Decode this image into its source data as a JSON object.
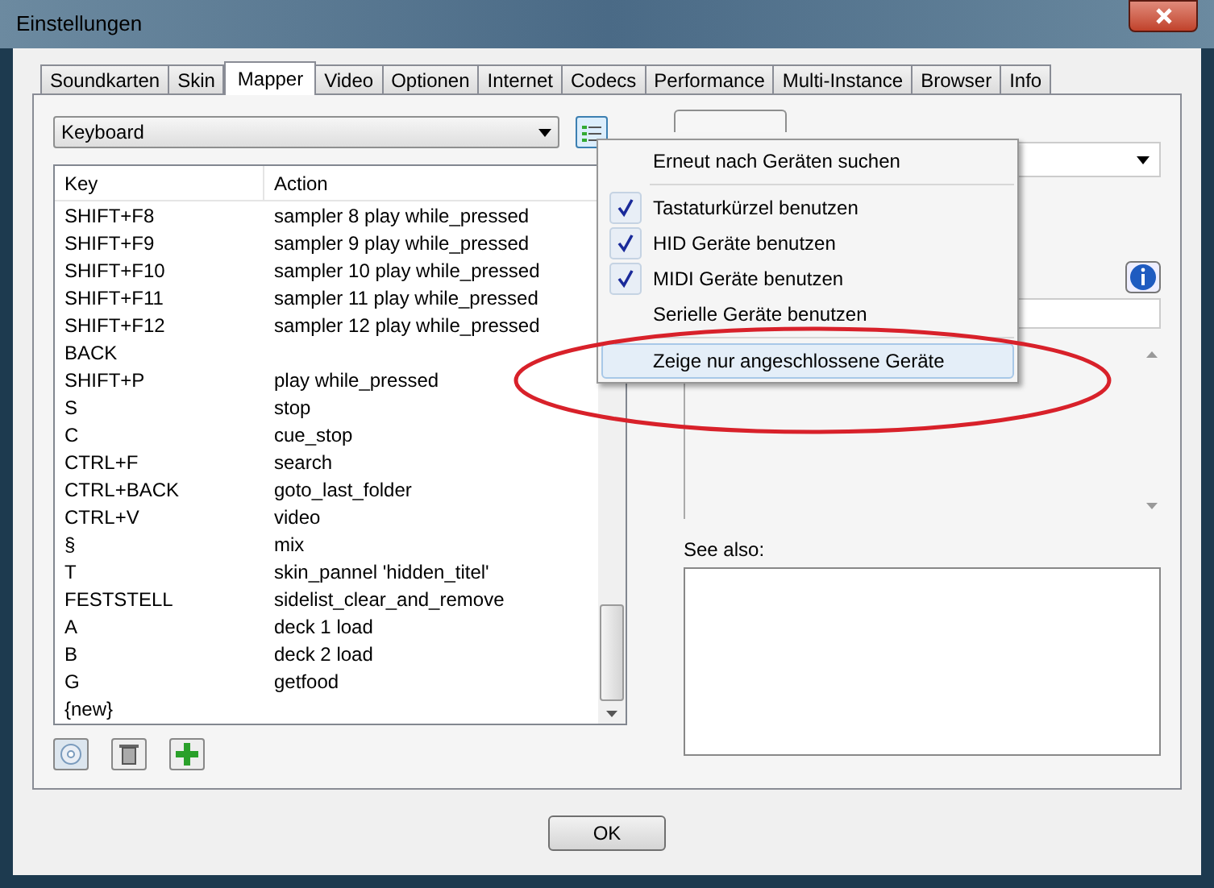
{
  "window": {
    "title": "Einstellungen"
  },
  "tabs": [
    {
      "label": "Soundkarten",
      "selected": false
    },
    {
      "label": "Skin",
      "selected": false
    },
    {
      "label": "Mapper",
      "selected": true
    },
    {
      "label": "Video",
      "selected": false
    },
    {
      "label": "Optionen",
      "selected": false
    },
    {
      "label": "Internet",
      "selected": false
    },
    {
      "label": "Codecs",
      "selected": false
    },
    {
      "label": "Performance",
      "selected": false
    },
    {
      "label": "Multi-Instance",
      "selected": false
    },
    {
      "label": "Browser",
      "selected": false
    },
    {
      "label": "Info",
      "selected": false
    }
  ],
  "device_select": {
    "value": "Keyboard"
  },
  "key_table": {
    "columns": [
      "Key",
      "Action"
    ],
    "rows": [
      {
        "key": "SHIFT+F8",
        "action": "sampler 8 play while_pressed"
      },
      {
        "key": "SHIFT+F9",
        "action": "sampler 9 play while_pressed"
      },
      {
        "key": "SHIFT+F10",
        "action": "sampler 10 play while_pressed"
      },
      {
        "key": "SHIFT+F11",
        "action": "sampler 11 play while_pressed"
      },
      {
        "key": "SHIFT+F12",
        "action": "sampler 12 play while_pressed"
      },
      {
        "key": "BACK"
      },
      {
        "key": "SHIFT+P",
        "action": "play while_pressed"
      },
      {
        "key": "S",
        "action": "stop"
      },
      {
        "key": "C",
        "action": "cue_stop"
      },
      {
        "key": "CTRL+F",
        "action": "search"
      },
      {
        "key": "CTRL+BACK",
        "action": "goto_last_folder"
      },
      {
        "key": "CTRL+V",
        "action": "video"
      },
      {
        "key": "§",
        "action": "mix"
      },
      {
        "key": "T",
        "action": "skin_pannel 'hidden_titel'"
      },
      {
        "key": "FESTSTELL",
        "action": "sidelist_clear_and_remove"
      },
      {
        "key": "A",
        "action": "deck 1 load"
      },
      {
        "key": "B",
        "action": "deck 2 load"
      },
      {
        "key": "G",
        "action": "getfood"
      },
      {
        "key": "{new}"
      }
    ]
  },
  "menu": {
    "items": [
      {
        "kind": "command",
        "label": "Erneut nach Geräten suchen",
        "selected": false
      },
      {
        "kind": "check",
        "label": "Tastaturkürzel benutzen",
        "checked": true,
        "selected": false
      },
      {
        "kind": "check",
        "label": "HID Geräte benutzen",
        "checked": true,
        "selected": false
      },
      {
        "kind": "check",
        "label": "MIDI Geräte benutzen",
        "checked": true,
        "selected": false
      },
      {
        "kind": "check",
        "label": "Serielle Geräte benutzen",
        "checked": false,
        "selected": false
      },
      {
        "kind": "command",
        "label": "Zeige nur angeschlossene Geräte",
        "selected": true
      }
    ]
  },
  "see_also": {
    "label": "See also:"
  },
  "ok_button": {
    "label": "OK"
  }
}
